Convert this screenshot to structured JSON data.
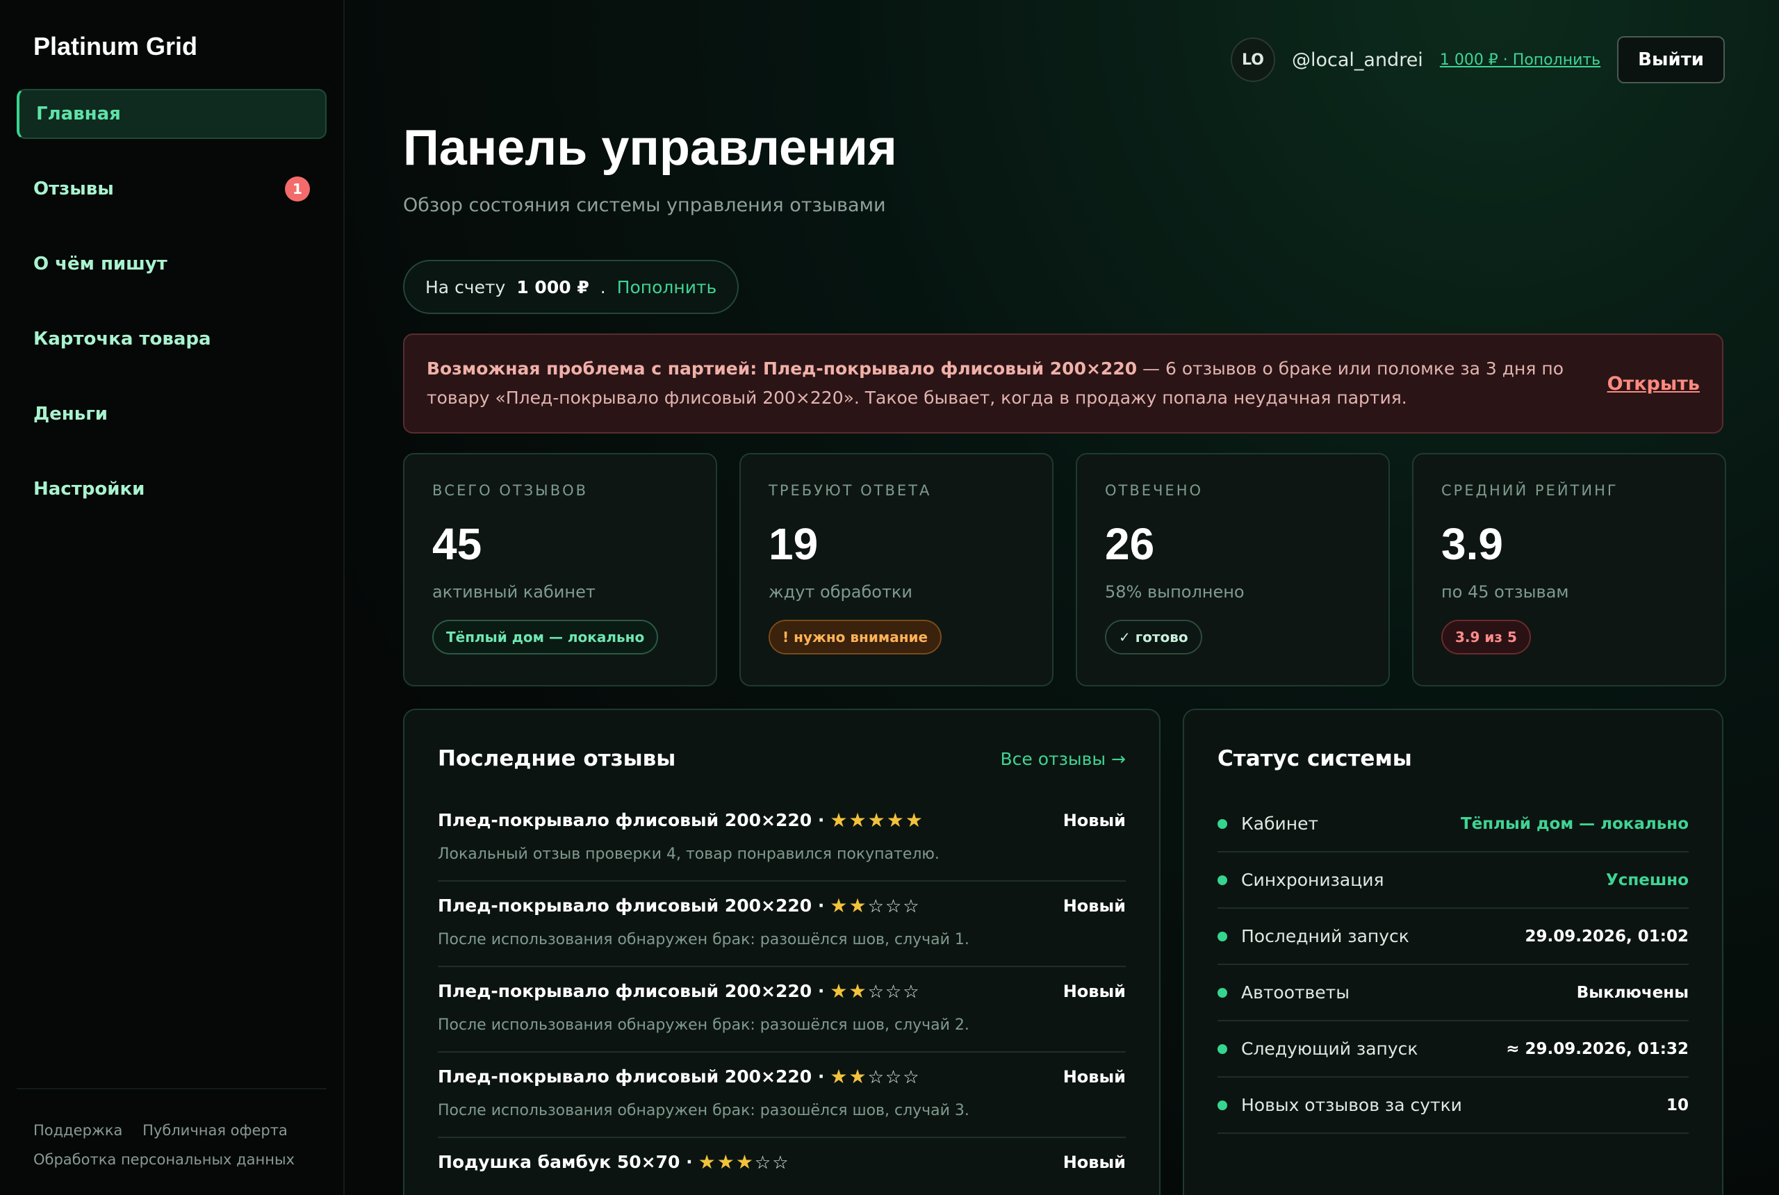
{
  "brand": "Platinum Grid",
  "nav": [
    {
      "label": "Главная",
      "active": true
    },
    {
      "label": "Отзывы",
      "badge": "1"
    },
    {
      "label": "О чём пишут"
    },
    {
      "label": "Карточка товара"
    },
    {
      "label": "Деньги"
    },
    {
      "label": "Настройки"
    }
  ],
  "footer": {
    "support": "Поддержка",
    "offer": "Публичная оферта",
    "privacy": "Обработка персональных данных"
  },
  "topbar": {
    "avatar": "LO",
    "username": "@local_andrei",
    "balance_link": "1 000 ₽ · Пополнить",
    "logout": "Выйти"
  },
  "page": {
    "title": "Панель управления",
    "subtitle": "Обзор состояния системы управления отзывами"
  },
  "balance": {
    "label": "На счету",
    "amount": "1 000 ₽",
    "sep": ".",
    "topup": "Пополнить"
  },
  "alert": {
    "title": "Возможная проблема с партией: Плед-покрывало флисовый 200×220",
    "text": " — 6 отзывов о браке или поломке за 3 дня по товару «Плед-покрывало флисовый 200×220». Такое бывает, когда в продажу попала неудачная партия.",
    "action": "Открыть"
  },
  "stats": [
    {
      "label": "ВСЕГО ОТЗЫВОВ",
      "value": "45",
      "note": "активный кабинет",
      "tag": "Тёплый дом — локально"
    },
    {
      "label": "ТРЕБУЮТ ОТВЕТА",
      "value": "19",
      "note": "ждут обработки",
      "tag": "! нужно внимание"
    },
    {
      "label": "ОТВЕЧЕНО",
      "value": "26",
      "note": "58% выполнено",
      "tag": "✓ готово"
    },
    {
      "label": "СРЕДНИЙ РЕЙТИНГ",
      "value": "3.9",
      "note": "по 45 отзывам",
      "tag": "3.9 из 5"
    }
  ],
  "reviews": {
    "title": "Последние отзывы",
    "link": "Все отзывы →",
    "items": [
      {
        "product": "Плед-покрывало флисовый 200×220 ·",
        "rating": 5,
        "status": "Новый",
        "text": "Локальный отзыв проверки 4, товар понравился покупателю."
      },
      {
        "product": "Плед-покрывало флисовый 200×220 ·",
        "rating": 2,
        "status": "Новый",
        "text": "После использования обнаружен брак: разошёлся шов, случай 1."
      },
      {
        "product": "Плед-покрывало флисовый 200×220 ·",
        "rating": 2,
        "status": "Новый",
        "text": "После использования обнаружен брак: разошёлся шов, случай 2."
      },
      {
        "product": "Плед-покрывало флисовый 200×220 ·",
        "rating": 2,
        "status": "Новый",
        "text": "После использования обнаружен брак: разошёлся шов, случай 3."
      },
      {
        "product": "Подушка бамбук 50×70 ·",
        "rating": 3,
        "status": "Новый",
        "text": ""
      }
    ]
  },
  "status": {
    "title": "Статус системы",
    "items": [
      {
        "label": "Кабинет",
        "value": "Тёплый дом — локально",
        "green": true
      },
      {
        "label": "Синхронизация",
        "value": "Успешно",
        "green": true
      },
      {
        "label": "Последний запуск",
        "value": "29.09.2026, 01:02"
      },
      {
        "label": "Автоответы",
        "value": "Выключены"
      },
      {
        "label": "Следующий запуск",
        "value": "≈ 29.09.2026, 01:32"
      },
      {
        "label": "Новых отзывов за сутки",
        "value": "10"
      }
    ]
  },
  "colors": {
    "accent": "#3fd494",
    "alert_bg": "#2a1416",
    "star": "#f2c23c",
    "badge": "#f36b6b"
  }
}
